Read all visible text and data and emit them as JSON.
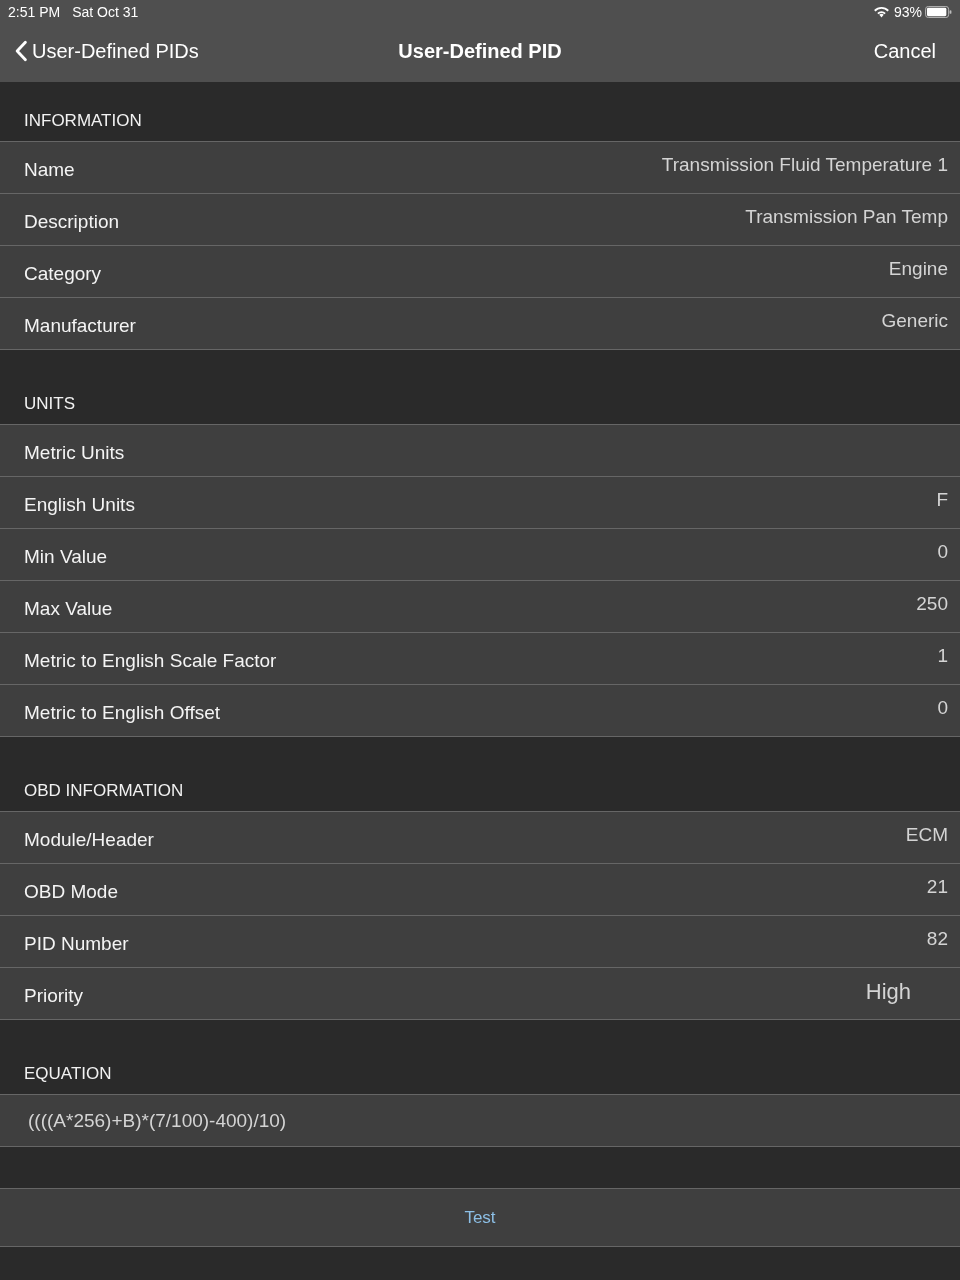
{
  "status_bar": {
    "time": "2:51 PM",
    "date": "Sat Oct 31",
    "battery": "93%"
  },
  "nav_bar": {
    "back": "User-Defined PIDs",
    "title": "User-Defined PID",
    "action": "Cancel"
  },
  "sections": [
    {
      "title": "INFORMATION",
      "rows": [
        {
          "kind": "text",
          "label": "Name",
          "value": "Transmission Fluid Temperature 1"
        },
        {
          "kind": "text",
          "label": "Description",
          "value": "Transmission Pan Temp"
        },
        {
          "kind": "text",
          "label": "Category",
          "value": "Engine"
        },
        {
          "kind": "text",
          "label": "Manufacturer",
          "value": "Generic"
        }
      ]
    },
    {
      "title": "UNITS",
      "rows": [
        {
          "kind": "text",
          "label": "Metric Units"
        },
        {
          "kind": "text",
          "label": "English Units",
          "value": "F"
        },
        {
          "kind": "text",
          "label": "Min Value",
          "value": "0"
        },
        {
          "kind": "text",
          "label": "Max Value",
          "value": "250"
        },
        {
          "kind": "text",
          "label": "Metric to English Scale Factor",
          "value": "1"
        },
        {
          "kind": "text",
          "label": "Metric to English Offset",
          "value": "0"
        }
      ]
    },
    {
      "title": "OBD INFORMATION",
      "rows": [
        {
          "kind": "text",
          "label": "Module/Header",
          "value": "ECM"
        },
        {
          "kind": "text",
          "label": "OBD Mode",
          "value": "21"
        },
        {
          "kind": "text",
          "label": "PID Number",
          "value": "82"
        },
        {
          "kind": "picker",
          "label": "Priority",
          "value": "High"
        }
      ]
    },
    {
      "title": "EQUATION",
      "rows": [
        {
          "kind": "field",
          "value": "((((A*256)+B)*(7/100)-400)/10)"
        }
      ]
    }
  ],
  "test_button": "Test"
}
